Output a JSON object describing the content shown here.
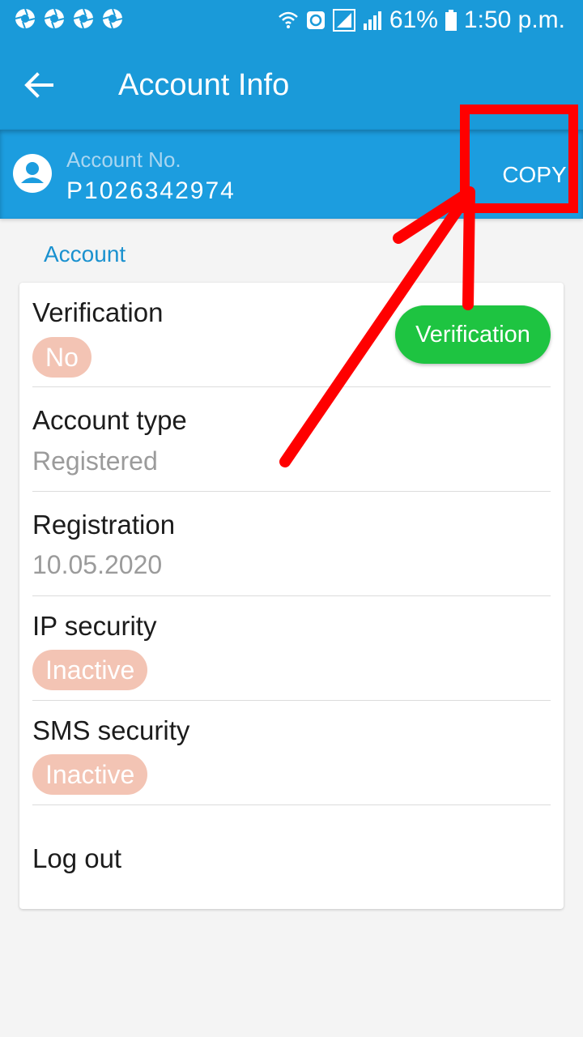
{
  "status_bar": {
    "notification_icons": [
      "aperture-icon",
      "aperture-icon",
      "aperture-icon",
      "aperture-icon"
    ],
    "battery_percent": "61%",
    "time": "1:50 p.m."
  },
  "app_bar": {
    "title": "Account Info"
  },
  "account": {
    "label": "Account No.",
    "number": "P1026342974",
    "copy_label": "COPY"
  },
  "section": {
    "title": "Account"
  },
  "rows": {
    "verification": {
      "label": "Verification",
      "status": "No",
      "button_label": "Verification"
    },
    "account_type": {
      "label": "Account type",
      "value": "Registered"
    },
    "registration": {
      "label": "Registration",
      "value": "10.05.2020"
    },
    "ip_security": {
      "label": "IP security",
      "status": "Inactive"
    },
    "sms_security": {
      "label": "SMS security",
      "status": "Inactive"
    }
  },
  "logout_label": "Log out",
  "colors": {
    "primary": "#1a9ad9",
    "accent_text": "#1a91cf",
    "verify_green": "#1ec441",
    "status_pill": "#f3c4b4",
    "annotation_red": "#ff0000"
  }
}
